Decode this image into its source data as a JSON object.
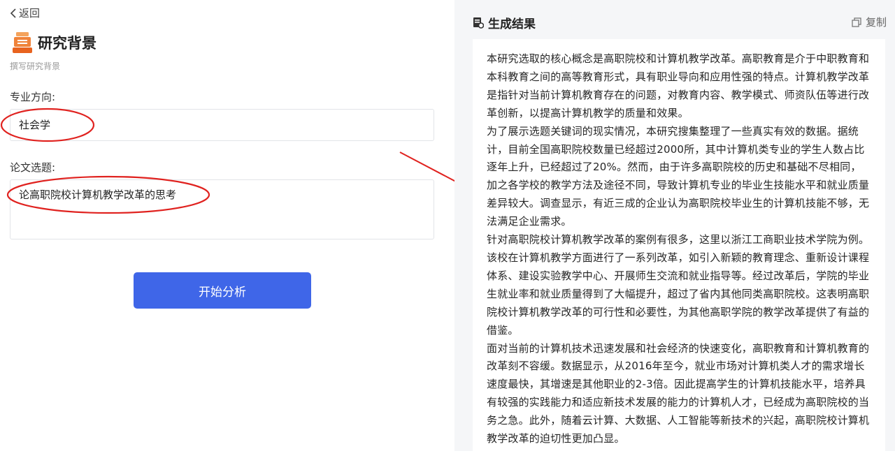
{
  "nav": {
    "back_label": "返回"
  },
  "header": {
    "title": "研究背景",
    "subtitle": "撰写研究背景"
  },
  "form": {
    "major_label": "专业方向:",
    "major_value": "社会学",
    "topic_label": "论文选题:",
    "topic_value": "论高职院校计算机教学改革的思考",
    "submit_label": "开始分析"
  },
  "result": {
    "title": "生成结果",
    "copy_label": "复制",
    "paragraphs": [
      "本研究选取的核心概念是高职院校和计算机教学改革。高职教育是介于中职教育和本科教育之间的高等教育形式，具有职业导向和应用性强的特点。计算机教学改革是指针对当前计算机教育存在的问题，对教育内容、教学模式、师资队伍等进行改革创新，以提高计算机教学的质量和效果。",
      "为了展示选题关键词的现实情况，本研究搜集整理了一些真实有效的数据。据统计，目前全国高职院校数量已经超过2000所，其中计算机类专业的学生人数占比逐年上升，已经超过了20%。然而，由于许多高职院校的历史和基础不尽相同，加之各学校的教学方法及途径不同，导致计算机专业的毕业生技能水平和就业质量差异较大。调查显示，有近三成的企业认为高职院校毕业生的计算机技能不够，无法满足企业需求。",
      "针对高职院校计算机教学改革的案例有很多，这里以浙江工商职业技术学院为例。该校在计算机教学方面进行了一系列改革，如引入新颖的教育理念、重新设计课程体系、建设实验教学中心、开展师生交流和就业指导等。经过改革后，学院的毕业生就业率和就业质量得到了大幅提升，超过了省内其他同类高职院校。这表明高职院校计算机教学改革的可行性和必要性，为其他高职学院的教学改革提供了有益的借鉴。",
      "面对当前的计算机技术迅速发展和社会经济的快速变化，高职教育和计算机教育的改革刻不容缓。数据显示，从2016年至今，就业市场对计算机类人才的需求增长速度最快，其增速是其他职业的2-3倍。因此提高学生的计算机技能水平，培养具有较强的实践能力和适应新技术发展的能力的计算机人才，已经成为高职院校的当务之急。此外，随着云计算、大数据、人工智能等新技术的兴起，高职院校计算机教学改革的迫切性更加凸显。"
    ]
  },
  "colors": {
    "primary": "#3f66e8",
    "annotation": "#e0221f",
    "panel_bg": "#f5f6f8"
  },
  "icons": [
    "chevron-left-icon",
    "document-stack-icon",
    "document-icon",
    "copy-icon"
  ]
}
